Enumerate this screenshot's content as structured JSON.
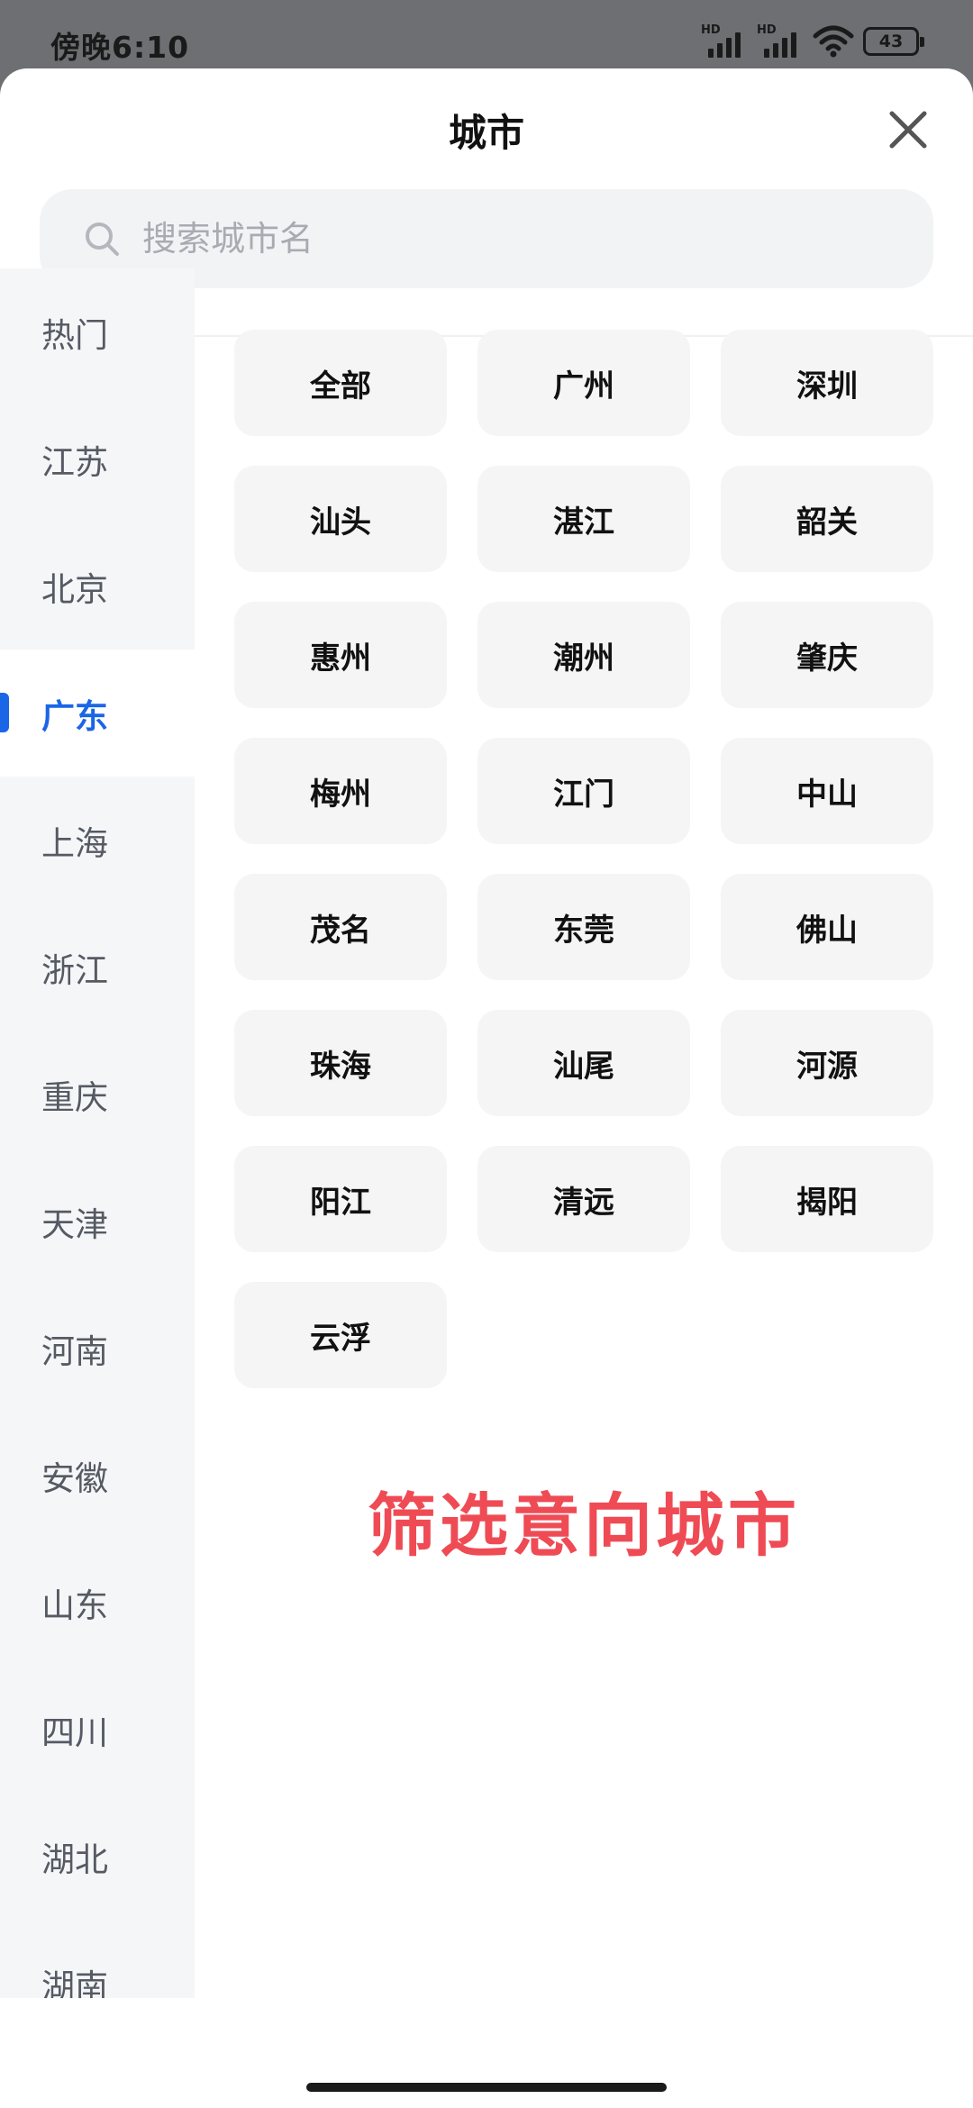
{
  "status_bar": {
    "time": "傍晚6:10",
    "signal_1_label": "HD",
    "signal_2_label": "HD",
    "battery": "43"
  },
  "sheet": {
    "title": "城市",
    "close_icon": "close-icon"
  },
  "search": {
    "placeholder": "搜索城市名",
    "icon": "search-icon"
  },
  "sidebar": {
    "items": [
      {
        "label": "热门"
      },
      {
        "label": "江苏"
      },
      {
        "label": "北京"
      },
      {
        "label": "广东",
        "active": true
      },
      {
        "label": "上海"
      },
      {
        "label": "浙江"
      },
      {
        "label": "重庆"
      },
      {
        "label": "天津"
      },
      {
        "label": "河南"
      },
      {
        "label": "安徽"
      },
      {
        "label": "山东"
      },
      {
        "label": "四川"
      },
      {
        "label": "湖北"
      },
      {
        "label": "湖南"
      }
    ]
  },
  "cities": [
    "全部",
    "广州",
    "深圳",
    "汕头",
    "湛江",
    "韶关",
    "惠州",
    "潮州",
    "肇庆",
    "梅州",
    "江门",
    "中山",
    "茂名",
    "东莞",
    "佛山",
    "珠海",
    "汕尾",
    "河源",
    "阳江",
    "清远",
    "揭阳",
    "云浮"
  ],
  "caption": "筛选意向城市",
  "colors": {
    "accent": "#1a66e6",
    "caption": "#ef4b55",
    "sidebar_bg": "#f5f6f8",
    "chip_bg": "#f5f5f6"
  }
}
